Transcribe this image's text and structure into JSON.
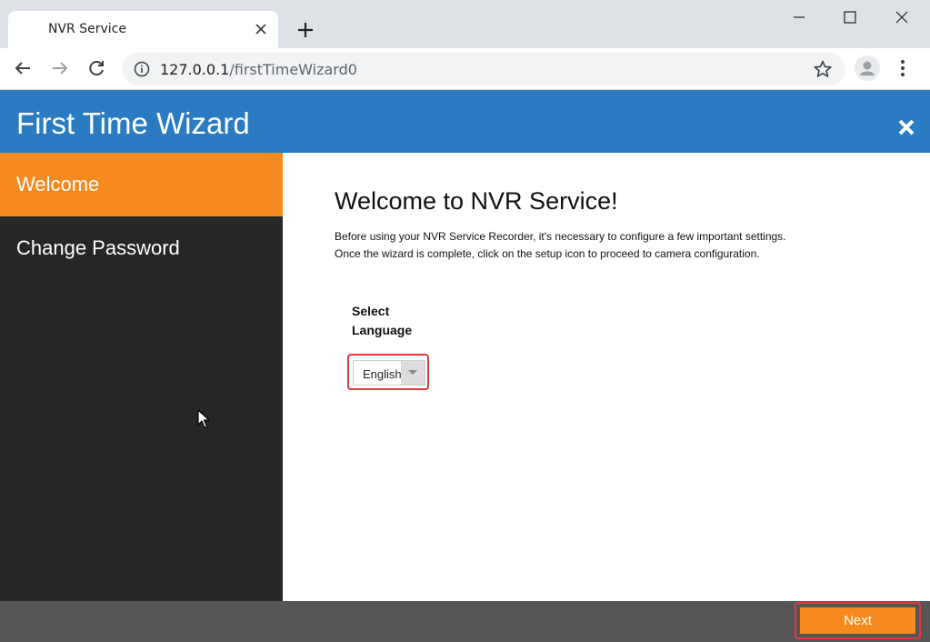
{
  "browser": {
    "tab_title": "NVR Service",
    "url_host": "127.0.0.1",
    "url_path": "/firstTimeWizard0",
    "icons": [
      "close-icon",
      "plus-icon",
      "minimize-icon",
      "maximize-icon",
      "window-close-icon",
      "back-icon",
      "forward-icon",
      "reload-icon",
      "info-icon",
      "star-icon",
      "profile-icon",
      "menu-dots-icon"
    ]
  },
  "app": {
    "title": "First Time Wizard",
    "accent_color": "#2a7bc1",
    "highlight_color": "#f68a1f"
  },
  "sidebar": {
    "items": [
      {
        "label": "Welcome",
        "active": true
      },
      {
        "label": "Change Password",
        "active": false
      }
    ]
  },
  "main": {
    "heading": "Welcome to NVR Service!",
    "description_line1": "Before using your NVR Service Recorder, it's necessary to configure a few important settings.",
    "description_line2": "Once the wizard is complete, click on the setup icon to proceed to camera configuration.",
    "language_label": "Select Language",
    "language_value": "English"
  },
  "footer": {
    "next_label": "Next"
  }
}
